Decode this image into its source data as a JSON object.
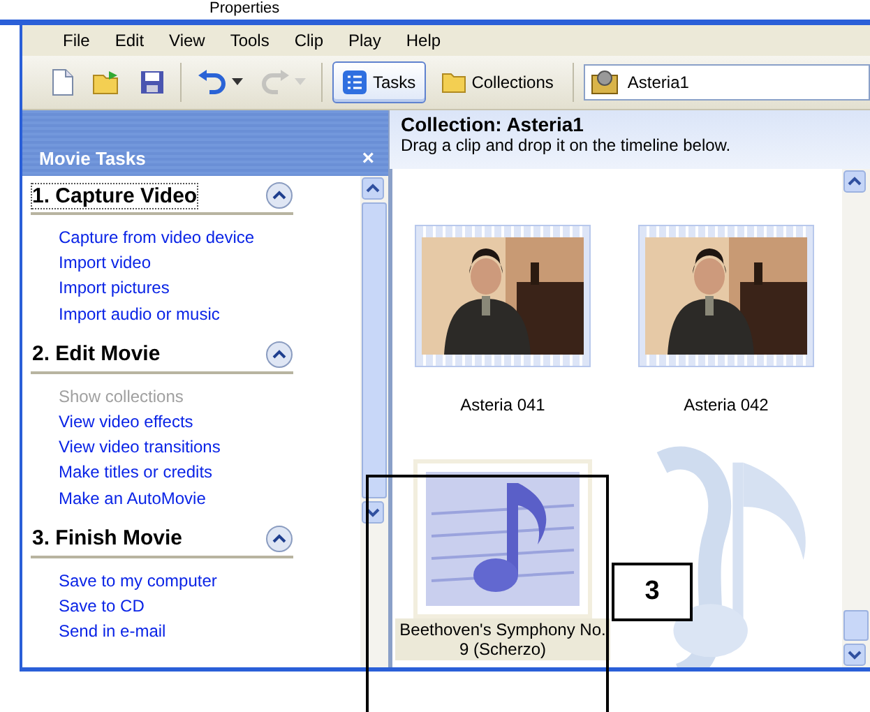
{
  "top_strip": {
    "text": "Properties"
  },
  "menu": [
    "File",
    "Edit",
    "View",
    "Tools",
    "Clip",
    "Play",
    "Help"
  ],
  "toolbar": {
    "buttons": [
      {
        "kind": "new"
      },
      {
        "kind": "open"
      },
      {
        "kind": "save"
      },
      {
        "kind": "undo",
        "disabled": false
      },
      {
        "kind": "redo",
        "disabled": true
      }
    ],
    "tabs": [
      {
        "label": "Tasks",
        "selected": true
      },
      {
        "label": "Collections",
        "selected": false
      }
    ],
    "collection_dropdown": {
      "value": "Asteria1"
    }
  },
  "task_pane": {
    "title": "Movie Tasks",
    "close": "×",
    "sections": [
      {
        "heading": "1. Capture Video",
        "expanded": true,
        "focused": true,
        "links": [
          {
            "label": "Capture from video device",
            "disabled": false
          },
          {
            "label": "Import video",
            "disabled": false
          },
          {
            "label": "Import pictures",
            "disabled": false
          },
          {
            "label": "Import audio or music",
            "disabled": false
          }
        ]
      },
      {
        "heading": "2. Edit Movie",
        "expanded": true,
        "focused": false,
        "links": [
          {
            "label": "Show collections",
            "disabled": true
          },
          {
            "label": "View video effects",
            "disabled": false
          },
          {
            "label": "View video transitions",
            "disabled": false
          },
          {
            "label": "Make titles or credits",
            "disabled": false
          },
          {
            "label": "Make an AutoMovie",
            "disabled": false
          }
        ]
      },
      {
        "heading": "3. Finish Movie",
        "expanded": true,
        "focused": false,
        "links": [
          {
            "label": "Save to my computer",
            "disabled": false
          },
          {
            "label": "Save to CD",
            "disabled": false
          },
          {
            "label": "Send in e-mail",
            "disabled": false
          }
        ]
      }
    ]
  },
  "collection": {
    "title": "Collection: Asteria1",
    "hint": "Drag a clip and drop it on the timeline below.",
    "clips": [
      {
        "kind": "video",
        "caption": "Asteria 041",
        "selected": false
      },
      {
        "kind": "video",
        "caption": "Asteria 042",
        "selected": false
      },
      {
        "kind": "audio",
        "caption": "Beethoven's Symphony No. 9 (Scherzo)",
        "selected": true
      }
    ]
  },
  "callout": {
    "label": "3"
  }
}
